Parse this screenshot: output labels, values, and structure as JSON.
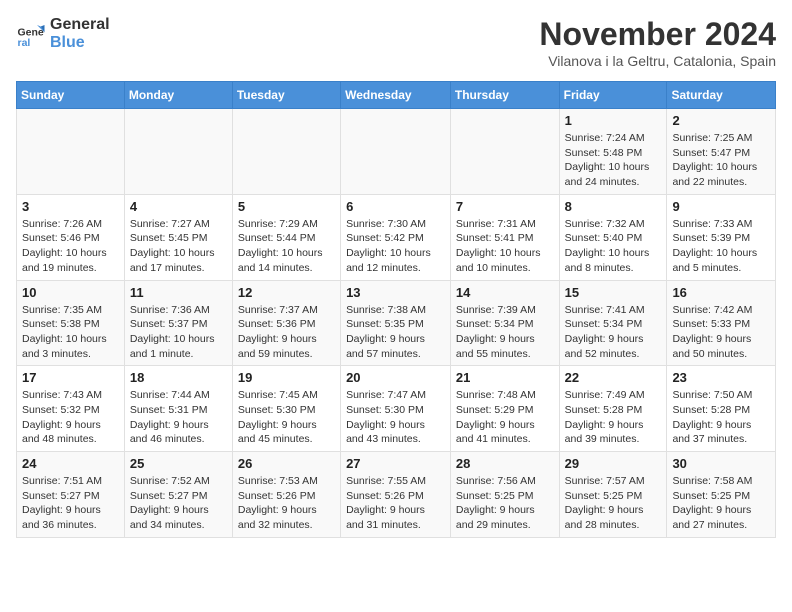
{
  "logo": {
    "line1": "General",
    "line2": "Blue"
  },
  "title": "November 2024",
  "subtitle": "Vilanova i la Geltru, Catalonia, Spain",
  "days_of_week": [
    "Sunday",
    "Monday",
    "Tuesday",
    "Wednesday",
    "Thursday",
    "Friday",
    "Saturday"
  ],
  "weeks": [
    [
      {
        "day": "",
        "info": ""
      },
      {
        "day": "",
        "info": ""
      },
      {
        "day": "",
        "info": ""
      },
      {
        "day": "",
        "info": ""
      },
      {
        "day": "",
        "info": ""
      },
      {
        "day": "1",
        "info": "Sunrise: 7:24 AM\nSunset: 5:48 PM\nDaylight: 10 hours and 24 minutes."
      },
      {
        "day": "2",
        "info": "Sunrise: 7:25 AM\nSunset: 5:47 PM\nDaylight: 10 hours and 22 minutes."
      }
    ],
    [
      {
        "day": "3",
        "info": "Sunrise: 7:26 AM\nSunset: 5:46 PM\nDaylight: 10 hours and 19 minutes."
      },
      {
        "day": "4",
        "info": "Sunrise: 7:27 AM\nSunset: 5:45 PM\nDaylight: 10 hours and 17 minutes."
      },
      {
        "day": "5",
        "info": "Sunrise: 7:29 AM\nSunset: 5:44 PM\nDaylight: 10 hours and 14 minutes."
      },
      {
        "day": "6",
        "info": "Sunrise: 7:30 AM\nSunset: 5:42 PM\nDaylight: 10 hours and 12 minutes."
      },
      {
        "day": "7",
        "info": "Sunrise: 7:31 AM\nSunset: 5:41 PM\nDaylight: 10 hours and 10 minutes."
      },
      {
        "day": "8",
        "info": "Sunrise: 7:32 AM\nSunset: 5:40 PM\nDaylight: 10 hours and 8 minutes."
      },
      {
        "day": "9",
        "info": "Sunrise: 7:33 AM\nSunset: 5:39 PM\nDaylight: 10 hours and 5 minutes."
      }
    ],
    [
      {
        "day": "10",
        "info": "Sunrise: 7:35 AM\nSunset: 5:38 PM\nDaylight: 10 hours and 3 minutes."
      },
      {
        "day": "11",
        "info": "Sunrise: 7:36 AM\nSunset: 5:37 PM\nDaylight: 10 hours and 1 minute."
      },
      {
        "day": "12",
        "info": "Sunrise: 7:37 AM\nSunset: 5:36 PM\nDaylight: 9 hours and 59 minutes."
      },
      {
        "day": "13",
        "info": "Sunrise: 7:38 AM\nSunset: 5:35 PM\nDaylight: 9 hours and 57 minutes."
      },
      {
        "day": "14",
        "info": "Sunrise: 7:39 AM\nSunset: 5:34 PM\nDaylight: 9 hours and 55 minutes."
      },
      {
        "day": "15",
        "info": "Sunrise: 7:41 AM\nSunset: 5:34 PM\nDaylight: 9 hours and 52 minutes."
      },
      {
        "day": "16",
        "info": "Sunrise: 7:42 AM\nSunset: 5:33 PM\nDaylight: 9 hours and 50 minutes."
      }
    ],
    [
      {
        "day": "17",
        "info": "Sunrise: 7:43 AM\nSunset: 5:32 PM\nDaylight: 9 hours and 48 minutes."
      },
      {
        "day": "18",
        "info": "Sunrise: 7:44 AM\nSunset: 5:31 PM\nDaylight: 9 hours and 46 minutes."
      },
      {
        "day": "19",
        "info": "Sunrise: 7:45 AM\nSunset: 5:30 PM\nDaylight: 9 hours and 45 minutes."
      },
      {
        "day": "20",
        "info": "Sunrise: 7:47 AM\nSunset: 5:30 PM\nDaylight: 9 hours and 43 minutes."
      },
      {
        "day": "21",
        "info": "Sunrise: 7:48 AM\nSunset: 5:29 PM\nDaylight: 9 hours and 41 minutes."
      },
      {
        "day": "22",
        "info": "Sunrise: 7:49 AM\nSunset: 5:28 PM\nDaylight: 9 hours and 39 minutes."
      },
      {
        "day": "23",
        "info": "Sunrise: 7:50 AM\nSunset: 5:28 PM\nDaylight: 9 hours and 37 minutes."
      }
    ],
    [
      {
        "day": "24",
        "info": "Sunrise: 7:51 AM\nSunset: 5:27 PM\nDaylight: 9 hours and 36 minutes."
      },
      {
        "day": "25",
        "info": "Sunrise: 7:52 AM\nSunset: 5:27 PM\nDaylight: 9 hours and 34 minutes."
      },
      {
        "day": "26",
        "info": "Sunrise: 7:53 AM\nSunset: 5:26 PM\nDaylight: 9 hours and 32 minutes."
      },
      {
        "day": "27",
        "info": "Sunrise: 7:55 AM\nSunset: 5:26 PM\nDaylight: 9 hours and 31 minutes."
      },
      {
        "day": "28",
        "info": "Sunrise: 7:56 AM\nSunset: 5:25 PM\nDaylight: 9 hours and 29 minutes."
      },
      {
        "day": "29",
        "info": "Sunrise: 7:57 AM\nSunset: 5:25 PM\nDaylight: 9 hours and 28 minutes."
      },
      {
        "day": "30",
        "info": "Sunrise: 7:58 AM\nSunset: 5:25 PM\nDaylight: 9 hours and 27 minutes."
      }
    ]
  ]
}
